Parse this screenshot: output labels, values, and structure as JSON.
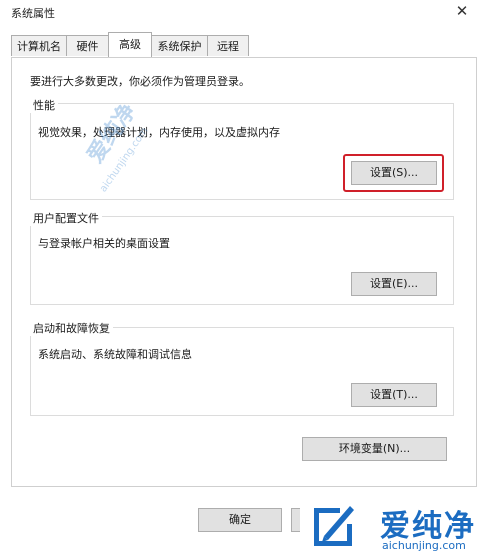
{
  "window": {
    "title": "系统属性",
    "close_glyph": "✕"
  },
  "tabs": [
    {
      "label": "计算机名",
      "active": false
    },
    {
      "label": "硬件",
      "active": false
    },
    {
      "label": "高级",
      "active": true
    },
    {
      "label": "系统保护",
      "active": false
    },
    {
      "label": "远程",
      "active": false
    }
  ],
  "advanced": {
    "admin_note": "要进行大多数更改，你必须作为管理员登录。",
    "performance": {
      "title": "性能",
      "description": "视觉效果，处理器计划，内存使用，以及虚拟内存",
      "button": "设置(S)..."
    },
    "user_profiles": {
      "title": "用户配置文件",
      "description": "与登录帐户相关的桌面设置",
      "button": "设置(E)..."
    },
    "startup_recovery": {
      "title": "启动和故障恢复",
      "description": "系统启动、系统故障和调试信息",
      "button": "设置(T)..."
    },
    "env_button": "环境变量(N)..."
  },
  "footer": {
    "ok_button": "确定"
  },
  "watermark": {
    "text_cn": "爱纯净",
    "text_url": "aichunjing.com"
  },
  "colors": {
    "highlight": "#d0202a",
    "brand": "#1b6cc1"
  }
}
